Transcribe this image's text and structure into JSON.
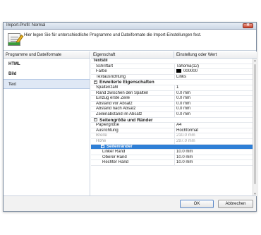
{
  "window": {
    "title": "Import-Profil: Normal",
    "close_label": "✕"
  },
  "header": {
    "text": "Hier legen Sie für unterschiedliche Programme und Dateiformate die Import-Einstellungen fest."
  },
  "left_panel": {
    "header": "Programme und Dateiformate",
    "items": [
      {
        "label": "HTML"
      },
      {
        "label": "Bild"
      },
      {
        "label": "Text"
      }
    ]
  },
  "grid": {
    "col_property": "Eigenschaft",
    "col_value": "Einstellung oder Wert",
    "rows": [
      {
        "type": "cat",
        "p": "Textstil",
        "v": ""
      },
      {
        "type": "row",
        "p": "Schriftart",
        "v": "Tahoma(12)"
      },
      {
        "type": "row",
        "p": "Farbe",
        "v": "000000"
      },
      {
        "type": "row",
        "p": "Textausrichtung",
        "v": "Links"
      },
      {
        "type": "group",
        "p": "Erweiterte Eigenschaften",
        "v": ""
      },
      {
        "type": "row",
        "p": "Spaltenzahl",
        "v": "1"
      },
      {
        "type": "row",
        "p": "Rand zwischen den Spalten",
        "v": "0.0 mm"
      },
      {
        "type": "row",
        "p": "Einzug erste Zeile",
        "v": "0.0 mm"
      },
      {
        "type": "row",
        "p": "Abstand vor Absatz",
        "v": "0.0 mm"
      },
      {
        "type": "row",
        "p": "Abstand nach Absatz",
        "v": "0.0 mm"
      },
      {
        "type": "row",
        "p": "Zeilenabstand im Absatz",
        "v": "0.0 mm"
      },
      {
        "type": "group",
        "p": "Seitengröße und Ränder",
        "v": ""
      },
      {
        "type": "row",
        "p": "Papiergröße",
        "v": "A4"
      },
      {
        "type": "row",
        "p": "Ausrichtung",
        "v": "Hochformat"
      },
      {
        "type": "disabled",
        "p": "Breite",
        "v": "210.0 mm"
      },
      {
        "type": "disabled",
        "p": "Höhe",
        "v": "297.0 mm"
      },
      {
        "type": "sub",
        "p": "Seitenränder",
        "v": ""
      },
      {
        "type": "indent2",
        "p": "Linker Rand",
        "v": "10.0 mm"
      },
      {
        "type": "indent2",
        "p": "Oberer Rand",
        "v": "10.0 mm"
      },
      {
        "type": "indent2",
        "p": "Rechter Rand",
        "v": "10.0 mm"
      }
    ]
  },
  "buttons": {
    "ok": "OK",
    "cancel": "Abbrechen"
  },
  "colors": {
    "selection": "#2f7fd6",
    "list_selected": "#dfe8f5",
    "swatch": "#000000"
  }
}
